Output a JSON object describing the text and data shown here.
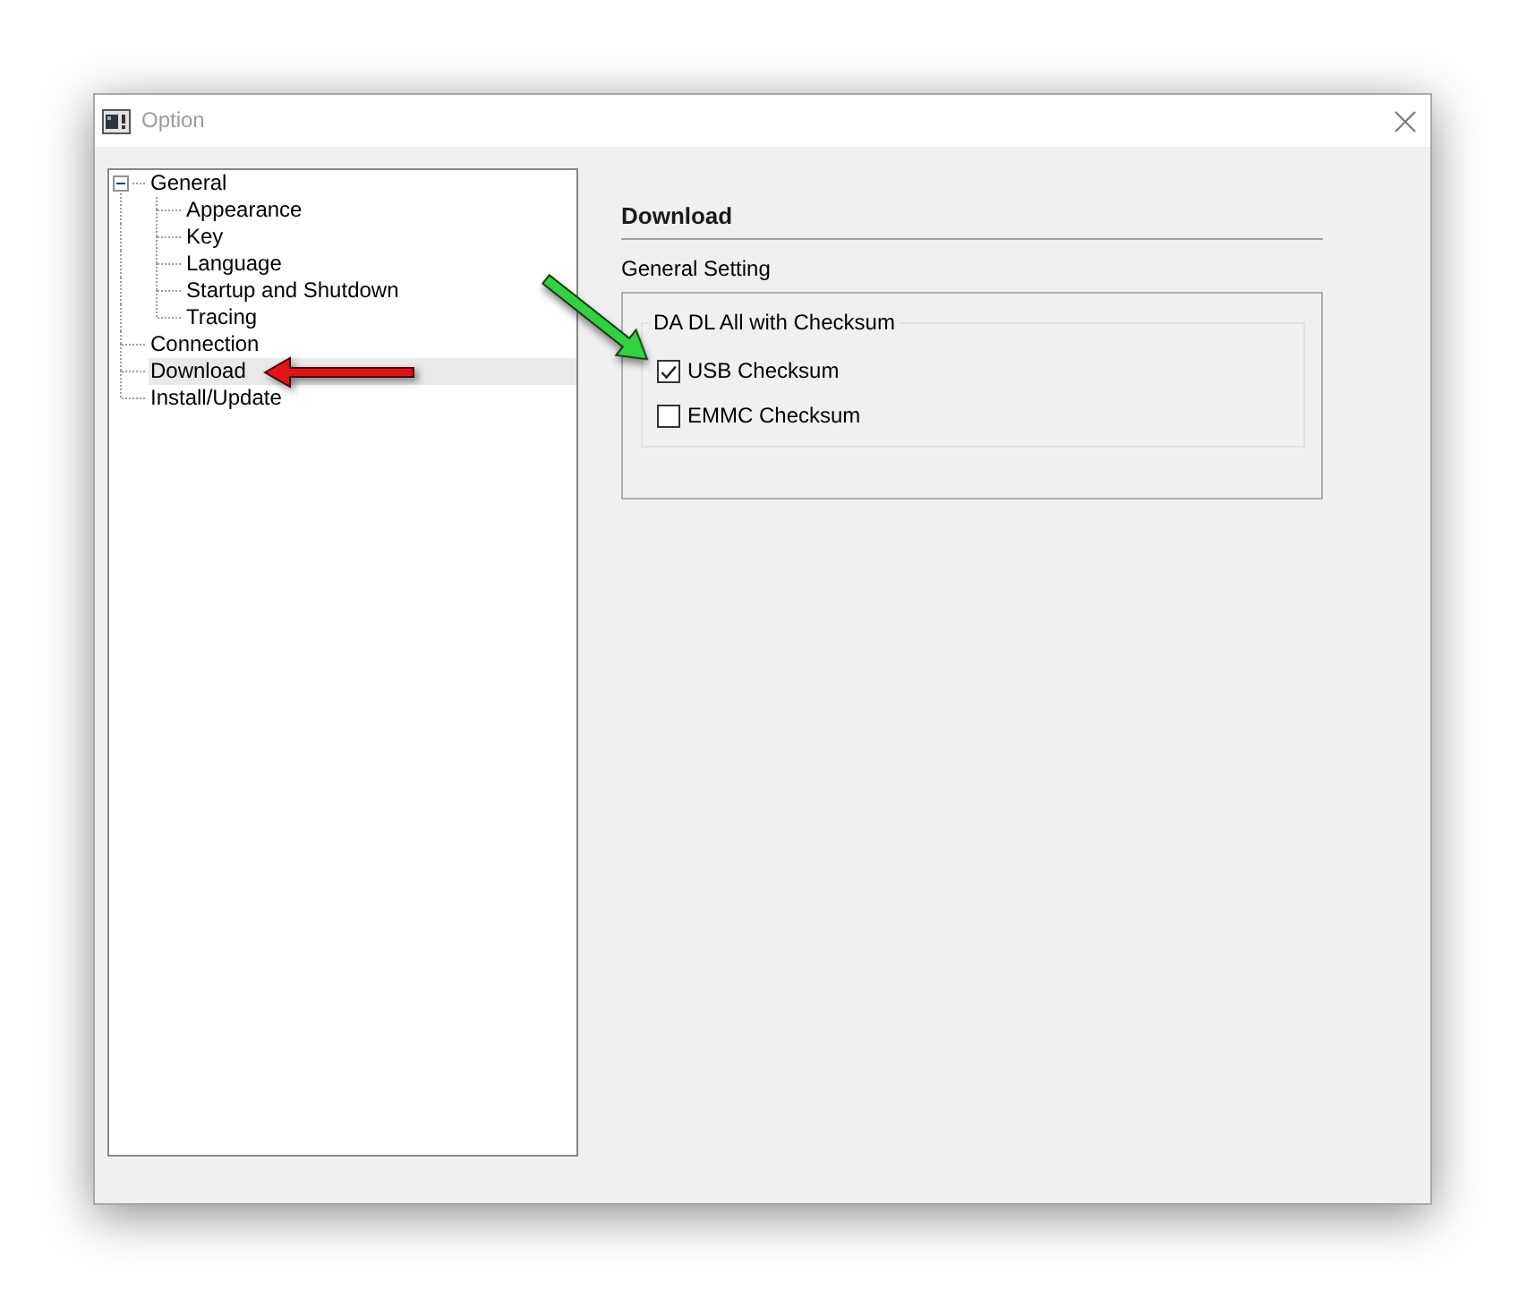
{
  "window": {
    "title": "Option"
  },
  "tree": {
    "items": [
      {
        "label": "General",
        "expanded": true,
        "selected": false,
        "children": [
          {
            "label": "Appearance",
            "selected": false
          },
          {
            "label": "Key",
            "selected": false
          },
          {
            "label": "Language",
            "selected": false
          },
          {
            "label": "Startup and Shutdown",
            "selected": false
          },
          {
            "label": "Tracing",
            "selected": false
          }
        ]
      },
      {
        "label": "Connection",
        "selected": false
      },
      {
        "label": "Download",
        "selected": true
      },
      {
        "label": "Install/Update",
        "selected": false
      }
    ]
  },
  "page": {
    "heading": "Download",
    "section_label": "General Setting",
    "group": {
      "title": "DA DL All with Checksum",
      "checkboxes": [
        {
          "label": "USB Checksum",
          "checked": true
        },
        {
          "label": "EMMC Checksum",
          "checked": false
        }
      ]
    }
  }
}
